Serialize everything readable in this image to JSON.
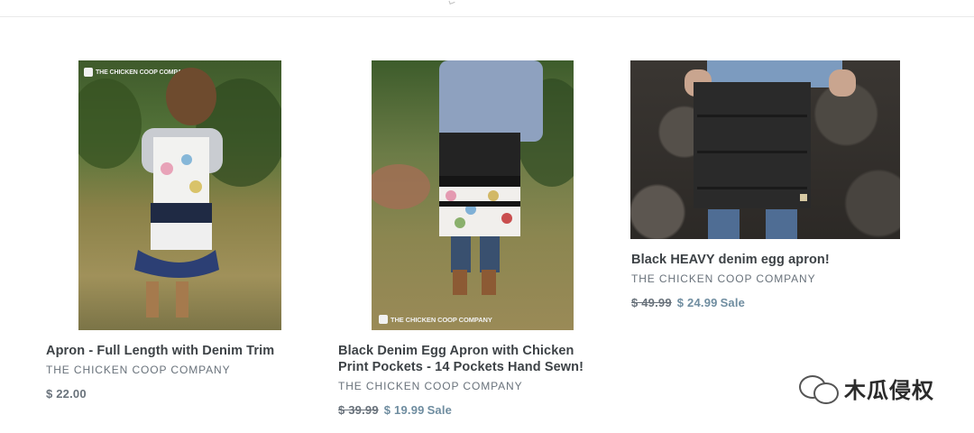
{
  "products": [
    {
      "title": "Apron - Full Length with Denim Trim",
      "vendor": "THE CHICKEN COOP COMPANY",
      "price": "$ 22.00",
      "image_caption": "THE CHICKEN COOP COMPANY"
    },
    {
      "title_line1": "Black Denim Egg Apron with Chicken",
      "title_line2": "Print Pockets - 14 Pockets Hand Sewn!",
      "vendor": "THE CHICKEN COOP COMPANY",
      "old_price": "$ 39.99",
      "sale_price": "$ 19.99",
      "sale_label": "Sale",
      "image_caption": "THE CHICKEN COOP COMPANY"
    },
    {
      "title": "Black HEAVY denim egg apron!",
      "vendor": "THE CHICKEN COOP COMPANY",
      "old_price": "$ 49.99",
      "sale_price": "$ 24.99",
      "sale_label": "Sale"
    }
  ],
  "watermark": {
    "text": "木瓜侵权"
  }
}
